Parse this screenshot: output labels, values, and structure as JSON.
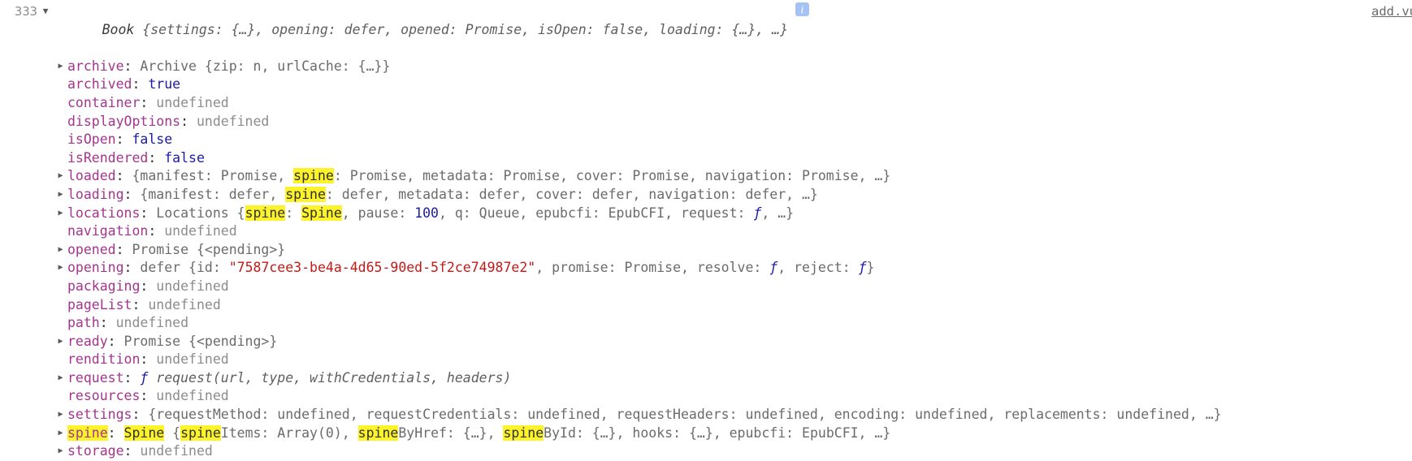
{
  "console": {
    "line_number": "333",
    "source_link": "add.vu",
    "info_badge": "i",
    "header": {
      "disclosure": "open",
      "constructor": "Book",
      "preview": " {settings: {…}, opening: defer, opened: Promise, isOpen: false, loading: {…}, …}"
    },
    "highlight_term": "spine",
    "rows": [
      {
        "disclosure": "closed",
        "key": "archive",
        "parts": [
          {
            "t": "ctor",
            "v": "Archive"
          },
          {
            "t": "plain",
            "v": " {zip: n, urlCache: {…}}"
          }
        ]
      },
      {
        "disclosure": "none",
        "key": "archived",
        "parts": [
          {
            "t": "bool",
            "v": "true"
          }
        ]
      },
      {
        "disclosure": "none",
        "key": "container",
        "parts": [
          {
            "t": "undef",
            "v": "undefined"
          }
        ]
      },
      {
        "disclosure": "none",
        "key": "displayOptions",
        "parts": [
          {
            "t": "undef",
            "v": "undefined"
          }
        ]
      },
      {
        "disclosure": "none",
        "key": "isOpen",
        "parts": [
          {
            "t": "bool",
            "v": "false"
          }
        ]
      },
      {
        "disclosure": "none",
        "key": "isRendered",
        "parts": [
          {
            "t": "bool",
            "v": "false"
          }
        ]
      },
      {
        "disclosure": "closed",
        "key": "loaded",
        "parts": [
          {
            "t": "plain",
            "v": "{manifest: Promise, "
          },
          {
            "t": "hl",
            "v": "spine"
          },
          {
            "t": "plain",
            "v": ": Promise, metadata: Promise, cover: Promise, navigation: Promise, …}"
          }
        ]
      },
      {
        "disclosure": "closed",
        "key": "loading",
        "parts": [
          {
            "t": "plain",
            "v": "{manifest: defer, "
          },
          {
            "t": "hl",
            "v": "spine"
          },
          {
            "t": "plain",
            "v": ": defer, metadata: defer, cover: defer, navigation: defer, …}"
          }
        ]
      },
      {
        "disclosure": "closed",
        "key": "locations",
        "parts": [
          {
            "t": "ctor",
            "v": "Locations"
          },
          {
            "t": "plain",
            "v": " {"
          },
          {
            "t": "hl",
            "v": "spine"
          },
          {
            "t": "plain",
            "v": ": "
          },
          {
            "t": "hl",
            "v": "Spine"
          },
          {
            "t": "plain",
            "v": ", pause: "
          },
          {
            "t": "num",
            "v": "100"
          },
          {
            "t": "plain",
            "v": ", q: Queue, epubcfi: EpubCFI, request: "
          },
          {
            "t": "fn",
            "v": "ƒ"
          },
          {
            "t": "plain",
            "v": ", …}"
          }
        ]
      },
      {
        "disclosure": "none",
        "key": "navigation",
        "parts": [
          {
            "t": "undef",
            "v": "undefined"
          }
        ]
      },
      {
        "disclosure": "closed",
        "key": "opened",
        "parts": [
          {
            "t": "ctor",
            "v": "Promise {<pending>}"
          }
        ]
      },
      {
        "disclosure": "closed",
        "key": "opening",
        "parts": [
          {
            "t": "plain",
            "v": "defer {id: "
          },
          {
            "t": "str",
            "v": "\"7587cee3-be4a-4d65-90ed-5f2ce74987e2\""
          },
          {
            "t": "plain",
            "v": ", promise: Promise, resolve: "
          },
          {
            "t": "fn",
            "v": "ƒ"
          },
          {
            "t": "plain",
            "v": ", reject: "
          },
          {
            "t": "fn",
            "v": "ƒ"
          },
          {
            "t": "plain",
            "v": "}"
          }
        ]
      },
      {
        "disclosure": "none",
        "key": "packaging",
        "parts": [
          {
            "t": "undef",
            "v": "undefined"
          }
        ]
      },
      {
        "disclosure": "none",
        "key": "pageList",
        "parts": [
          {
            "t": "undef",
            "v": "undefined"
          }
        ]
      },
      {
        "disclosure": "none",
        "key": "path",
        "parts": [
          {
            "t": "undef",
            "v": "undefined"
          }
        ]
      },
      {
        "disclosure": "closed",
        "key": "ready",
        "parts": [
          {
            "t": "ctor",
            "v": "Promise {<pending>}"
          }
        ]
      },
      {
        "disclosure": "none",
        "key": "rendition",
        "parts": [
          {
            "t": "undef",
            "v": "undefined"
          }
        ]
      },
      {
        "disclosure": "closed",
        "key": "request",
        "parts": [
          {
            "t": "fn",
            "v": "ƒ"
          },
          {
            "t": "fnsig",
            "v": " request(url, type, withCredentials, headers)"
          }
        ]
      },
      {
        "disclosure": "none",
        "key": "resources",
        "parts": [
          {
            "t": "undef",
            "v": "undefined"
          }
        ]
      },
      {
        "disclosure": "closed",
        "key": "settings",
        "parts": [
          {
            "t": "plain",
            "v": "{requestMethod: undefined, requestCredentials: undefined, requestHeaders: undefined, encoding: undefined, replacements: undefined, …}"
          }
        ]
      },
      {
        "disclosure": "closed",
        "key": "spine",
        "key_highlight": true,
        "parts": [
          {
            "t": "hl",
            "v": "Spine"
          },
          {
            "t": "plain",
            "v": " {"
          },
          {
            "t": "hl",
            "v": "spine"
          },
          {
            "t": "plain",
            "v": "Items: Array(0), "
          },
          {
            "t": "hl",
            "v": "spine"
          },
          {
            "t": "plain",
            "v": "ByHref: {…}, "
          },
          {
            "t": "hl",
            "v": "spine"
          },
          {
            "t": "plain",
            "v": "ById: {…}, hooks: {…}, epubcfi: EpubCFI, …}"
          }
        ]
      },
      {
        "disclosure": "closed",
        "key": "storage",
        "clipped": true,
        "parts": [
          {
            "t": "undef",
            "v": "undefined"
          }
        ]
      }
    ]
  }
}
